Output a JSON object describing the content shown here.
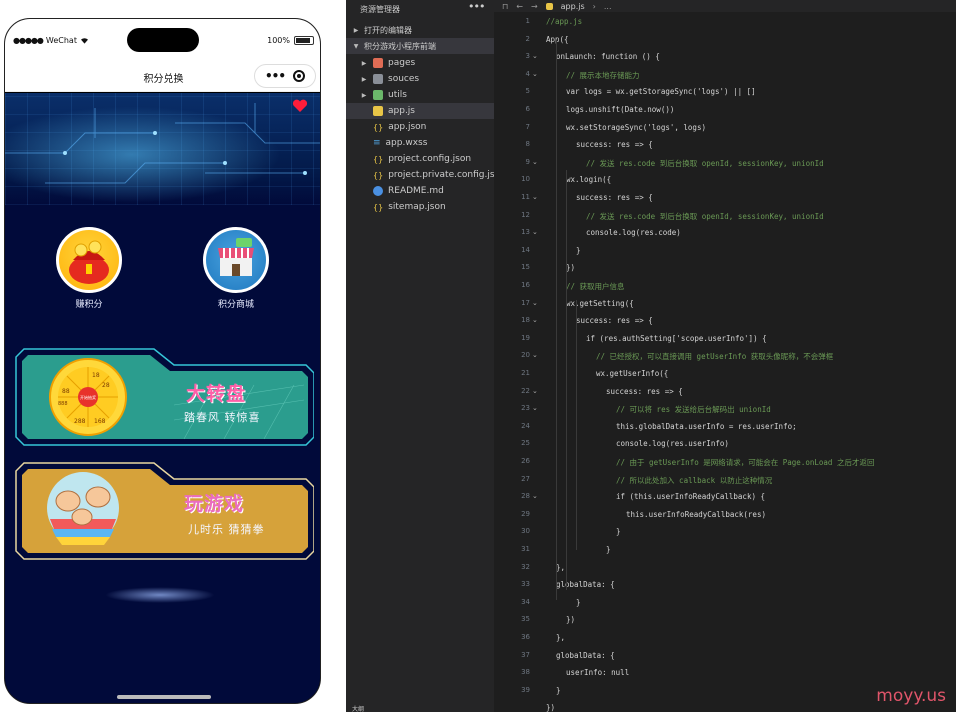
{
  "phone": {
    "carrier": "WeChat",
    "battery": "100%",
    "nav_title": "积分兑换",
    "categories": [
      {
        "label": "赚积分",
        "icon": "red-envelope-icon"
      },
      {
        "label": "积分商城",
        "icon": "shop-icon"
      }
    ],
    "cards": [
      {
        "title": "大转盘",
        "subtitle": "踏春风 转惊喜",
        "icon": "prize-wheel-icon"
      },
      {
        "title": "玩游戏",
        "subtitle": "儿时乐 猜猜拳",
        "icon": "rock-paper-scissors-icon"
      }
    ],
    "wheel_numbers": [
      "18",
      "28",
      "88",
      "888",
      "288",
      "168"
    ],
    "wheel_center": "开始抽奖",
    "colors": {
      "screen_bg": "#010a3a",
      "card1": "#2fa58f",
      "card2": "#d7a33a"
    }
  },
  "explorer": {
    "title": "资源管理器",
    "sections": [
      {
        "label": "打开的编辑器",
        "expanded": false
      },
      {
        "label": "积分游戏小程序前端",
        "expanded": true
      }
    ],
    "items": [
      {
        "label": "pages",
        "type": "folder"
      },
      {
        "label": "souces",
        "type": "folder"
      },
      {
        "label": "utils",
        "type": "folder"
      },
      {
        "label": "app.js",
        "type": "js",
        "selected": true
      },
      {
        "label": "app.json",
        "type": "json"
      },
      {
        "label": "app.wxss",
        "type": "wxss"
      },
      {
        "label": "project.config.json",
        "type": "json"
      },
      {
        "label": "project.private.config.js...",
        "type": "json"
      },
      {
        "label": "README.md",
        "type": "md"
      },
      {
        "label": "sitemap.json",
        "type": "json"
      }
    ],
    "outline_label": "大纲"
  },
  "editor": {
    "breadcrumb_file": "app.js",
    "breadcrumb_more": "...",
    "line_numbers": [
      "1",
      "2",
      "3",
      "4",
      "5",
      "6",
      "7",
      "8",
      "9",
      "10",
      "11",
      "12",
      "13",
      "14",
      "15",
      "16",
      "17",
      "18",
      "19",
      "20",
      "21",
      "22",
      "23",
      "24",
      "25",
      "26",
      "27",
      "28",
      "29",
      "30",
      "31",
      "32",
      "33",
      "34",
      "35",
      "36",
      "37",
      "38",
      "39"
    ],
    "lines": [
      "//app.js",
      "App({",
      "onLaunch: function () {",
      "// 展示本地存储能力",
      "var logs = wx.getStorageSync('logs') || []",
      "logs.unshift(Date.now())",
      "wx.setStorageSync('logs', logs)",
      "success: res => {",
      "// 发送 res.code 到后台换取 openId, sessionKey, unionId",
      "wx.login({",
      "success: res => {",
      "// 发送 res.code 到后台换取 openId, sessionKey, unionId",
      "console.log(res.code)",
      "}",
      "})",
      "// 获取用户信息",
      "wx.getSetting({",
      "success: res => {",
      "if (res.authSetting['scope.userInfo']) {",
      "// 已经授权，可以直接调用 getUserInfo 获取头像昵称，不会弹框",
      "wx.getUserInfo({",
      "success: res => {",
      "// 可以将 res 发送给后台解码出 unionId",
      "this.globalData.userInfo = res.userInfo;",
      "console.log(res.userInfo)",
      "// 由于 getUserInfo 是网络请求，可能会在 Page.onLoad 之后才返回",
      "// 所以此处加入 callback 以防止这种情况",
      "if (this.userInfoReadyCallback) {",
      "this.userInfoReadyCallback(res)",
      "}",
      "}",
      "},",
      "globalData: {",
      "}",
      "})",
      "},",
      "globalData: {",
      "userInfo: null",
      "}",
      "})"
    ]
  },
  "watermark": "moyy.us"
}
